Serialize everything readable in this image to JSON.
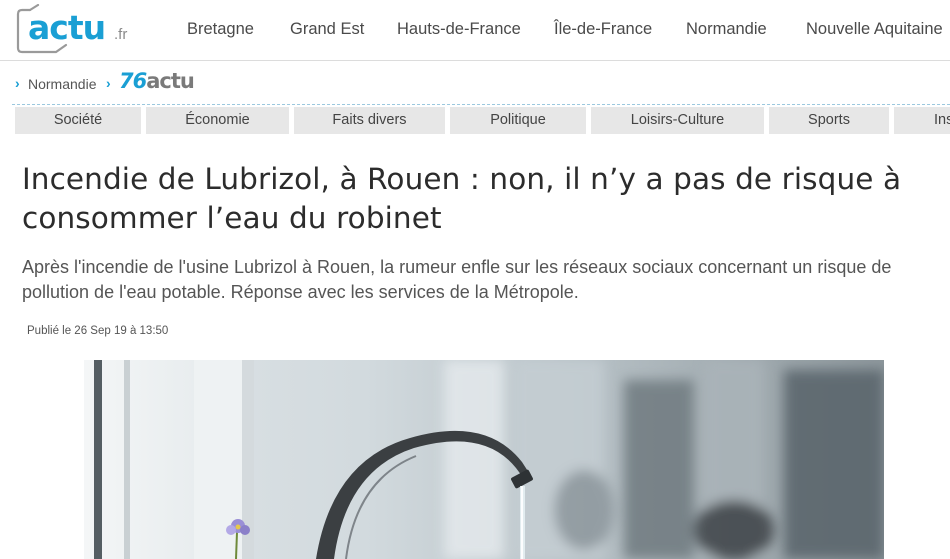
{
  "site": {
    "logo_text": "actu",
    "logo_tld": ".fr"
  },
  "regions": [
    "Bretagne",
    "Grand Est",
    "Hauts-de-France",
    "Île-de-France",
    "Normandie",
    "Nouvelle Aquitaine"
  ],
  "breadcrumb": {
    "region": "Normandie",
    "local_prefix": "76",
    "local_suffix": "actu"
  },
  "categories": [
    "Société",
    "Économie",
    "Faits divers",
    "Politique",
    "Loisirs-Culture",
    "Sports",
    "Ins"
  ],
  "article": {
    "title": "Incendie de Lubrizol, à Rouen : non, il n’y a pas de risque à consommer l’eau du robinet",
    "lead": "Après l'incendie de l'usine Lubrizol à Rouen, la rumeur enfle sur les réseaux sociaux concernant un risque de pollution de l'eau potable. Réponse avec les services de la Métropole.",
    "published": "Publié le 26 Sep 19 à 13:50"
  },
  "colors": {
    "brand": "#1a9fd4",
    "category_bg": "#e7e7e7",
    "title": "#2c2c2c"
  }
}
